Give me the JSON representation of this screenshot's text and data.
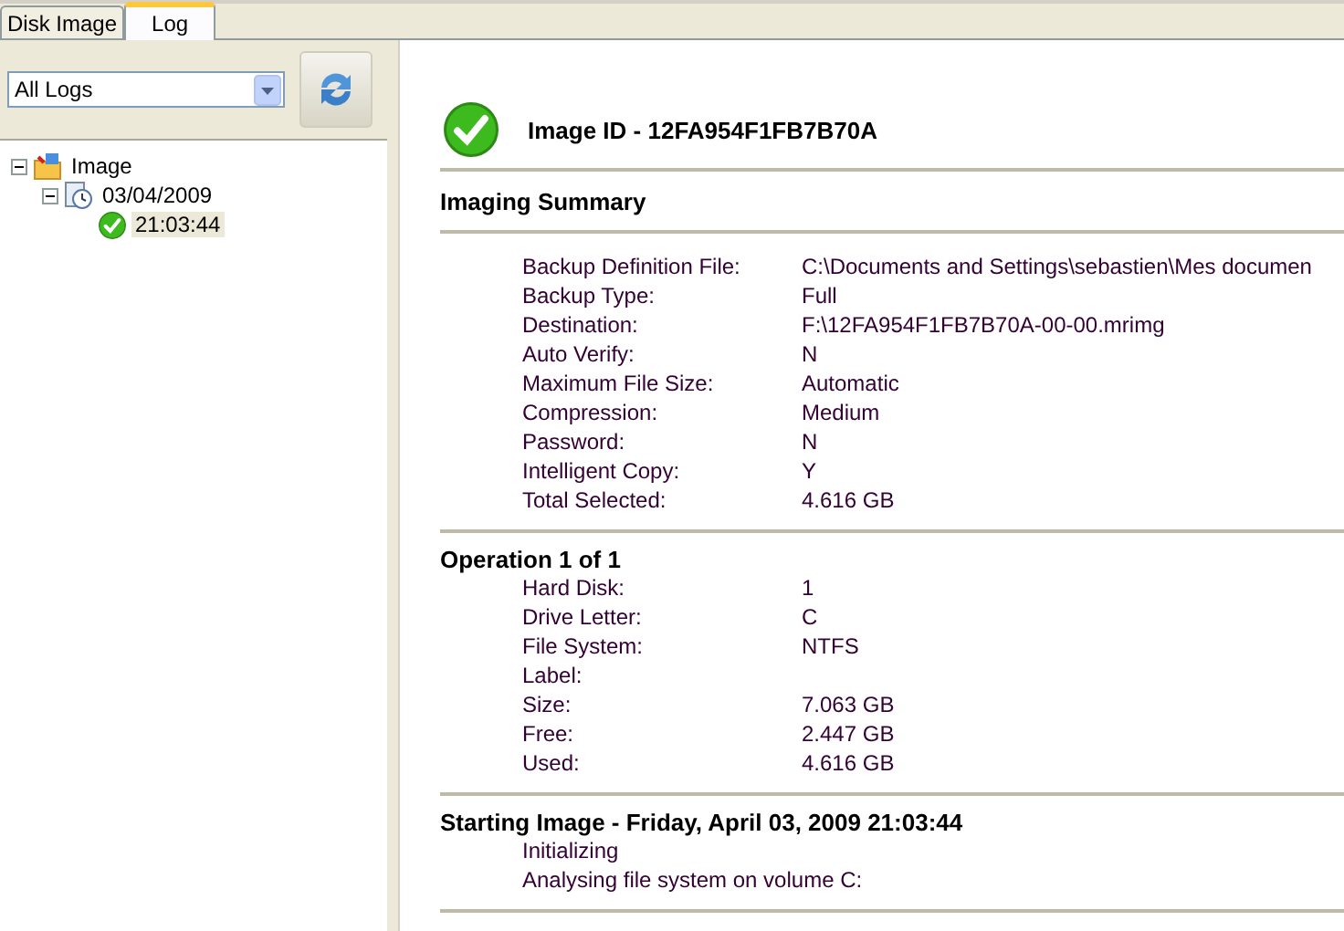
{
  "tabs": [
    {
      "label": "Disk Image",
      "selected": false
    },
    {
      "label": "Log",
      "selected": true
    }
  ],
  "filter": {
    "value": "All Logs"
  },
  "tree": [
    {
      "label": "Image",
      "kind": "folder",
      "expanded": true,
      "selected": false,
      "children": [
        {
          "label": "03/04/2009",
          "kind": "log",
          "expanded": true,
          "selected": false,
          "children": [
            {
              "label": "21:03:44",
              "kind": "success",
              "selected": true
            }
          ]
        }
      ]
    }
  ],
  "header": {
    "title": "Image ID - 12FA954F1FB7B70A"
  },
  "sections": [
    {
      "title": "Imaging Summary",
      "rows": [
        {
          "label": "Backup Definition File:",
          "value": "C:\\Documents and Settings\\sebastien\\Mes documen"
        },
        {
          "label": "Backup Type:",
          "value": "Full"
        },
        {
          "label": "Destination:",
          "value": "F:\\12FA954F1FB7B70A-00-00.mrimg"
        },
        {
          "label": "Auto Verify:",
          "value": "N"
        },
        {
          "label": "Maximum File Size:",
          "value": "Automatic"
        },
        {
          "label": "Compression:",
          "value": "Medium"
        },
        {
          "label": "Password:",
          "value": "N"
        },
        {
          "label": "Intelligent Copy:",
          "value": "Y"
        },
        {
          "label": "Total Selected:",
          "value": "4.616 GB"
        }
      ]
    },
    {
      "title": "Operation 1 of 1",
      "rows": [
        {
          "label": "Hard Disk:",
          "value": "1"
        },
        {
          "label": "Drive Letter:",
          "value": "C"
        },
        {
          "label": "File System:",
          "value": "NTFS"
        },
        {
          "label": "Label:"
        },
        {
          "label": "Size:",
          "value": "7.063 GB"
        },
        {
          "label": "Free:",
          "value": "2.447 GB"
        },
        {
          "label": "Used:",
          "value": "4.616 GB"
        }
      ]
    },
    {
      "title": "Starting Image - Friday, April 03, 2009 21:03:44",
      "rows": [
        {
          "label": "Initializing"
        },
        {
          "label": "Analysing file system on volume C:"
        }
      ]
    }
  ]
}
